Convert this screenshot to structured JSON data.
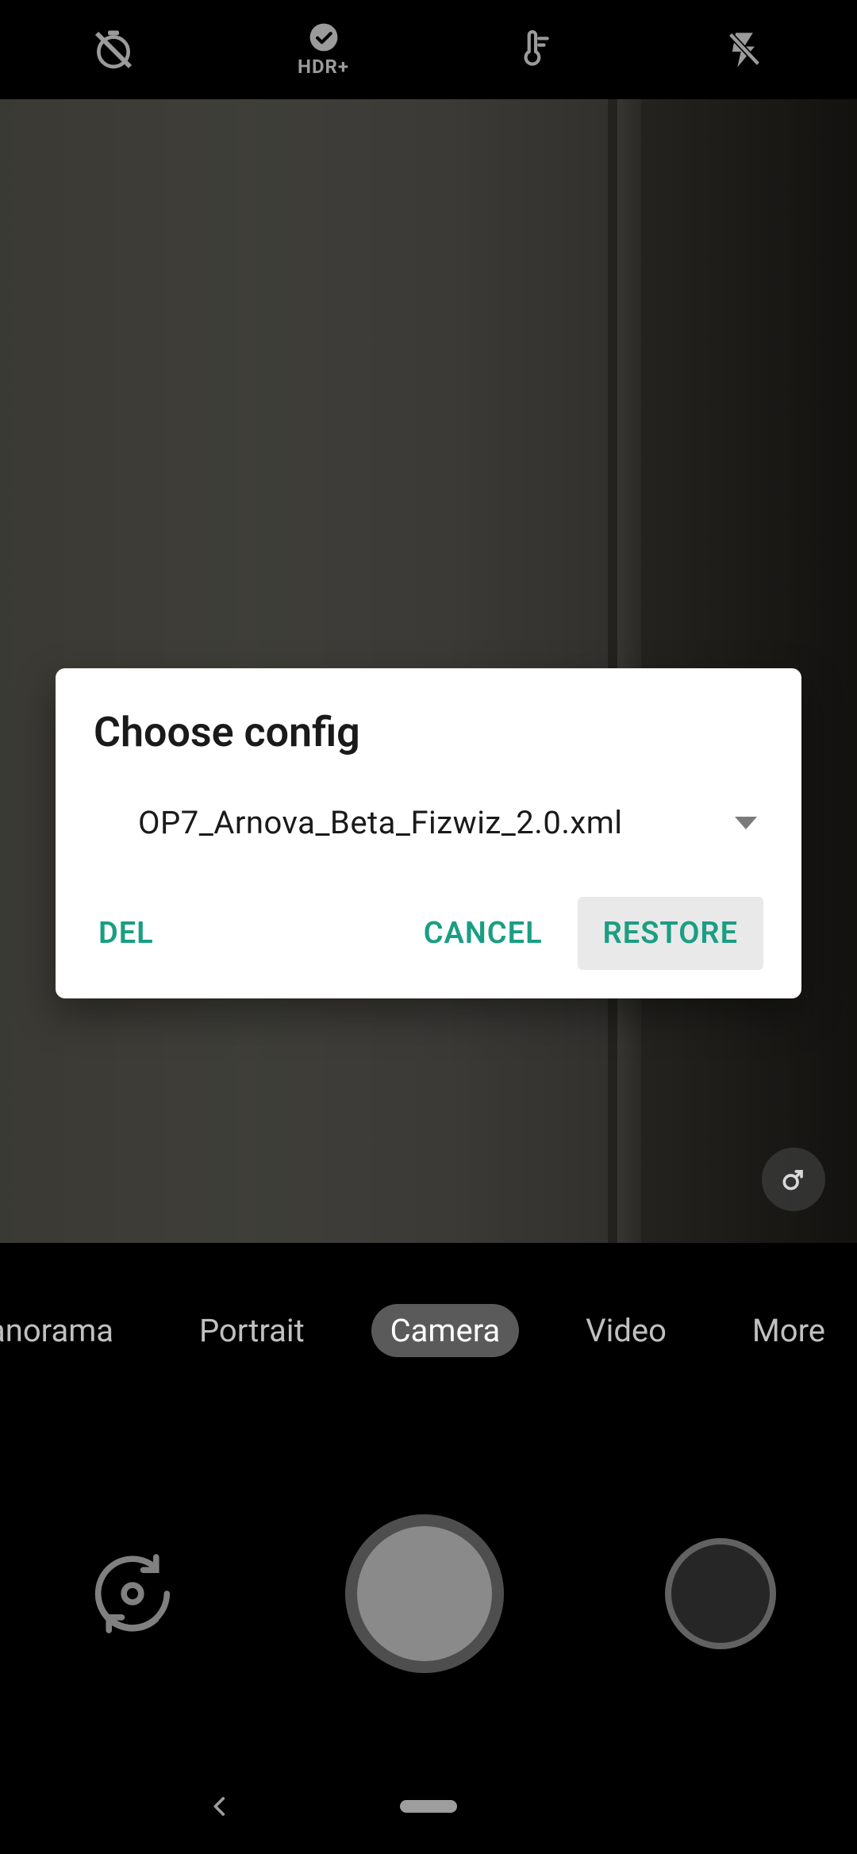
{
  "toolbar": {
    "hdr_label": "HDR+"
  },
  "modes": {
    "panorama": "Panorama",
    "portrait": "Portrait",
    "camera": "Camera",
    "video": "Video",
    "more": "More"
  },
  "dialog": {
    "title": "Choose config",
    "selected_file": "OP7_Arnova_Beta_Fizwiz_2.0.xml",
    "del_label": "DEL",
    "cancel_label": "CANCEL",
    "restore_label": "RESTORE"
  }
}
